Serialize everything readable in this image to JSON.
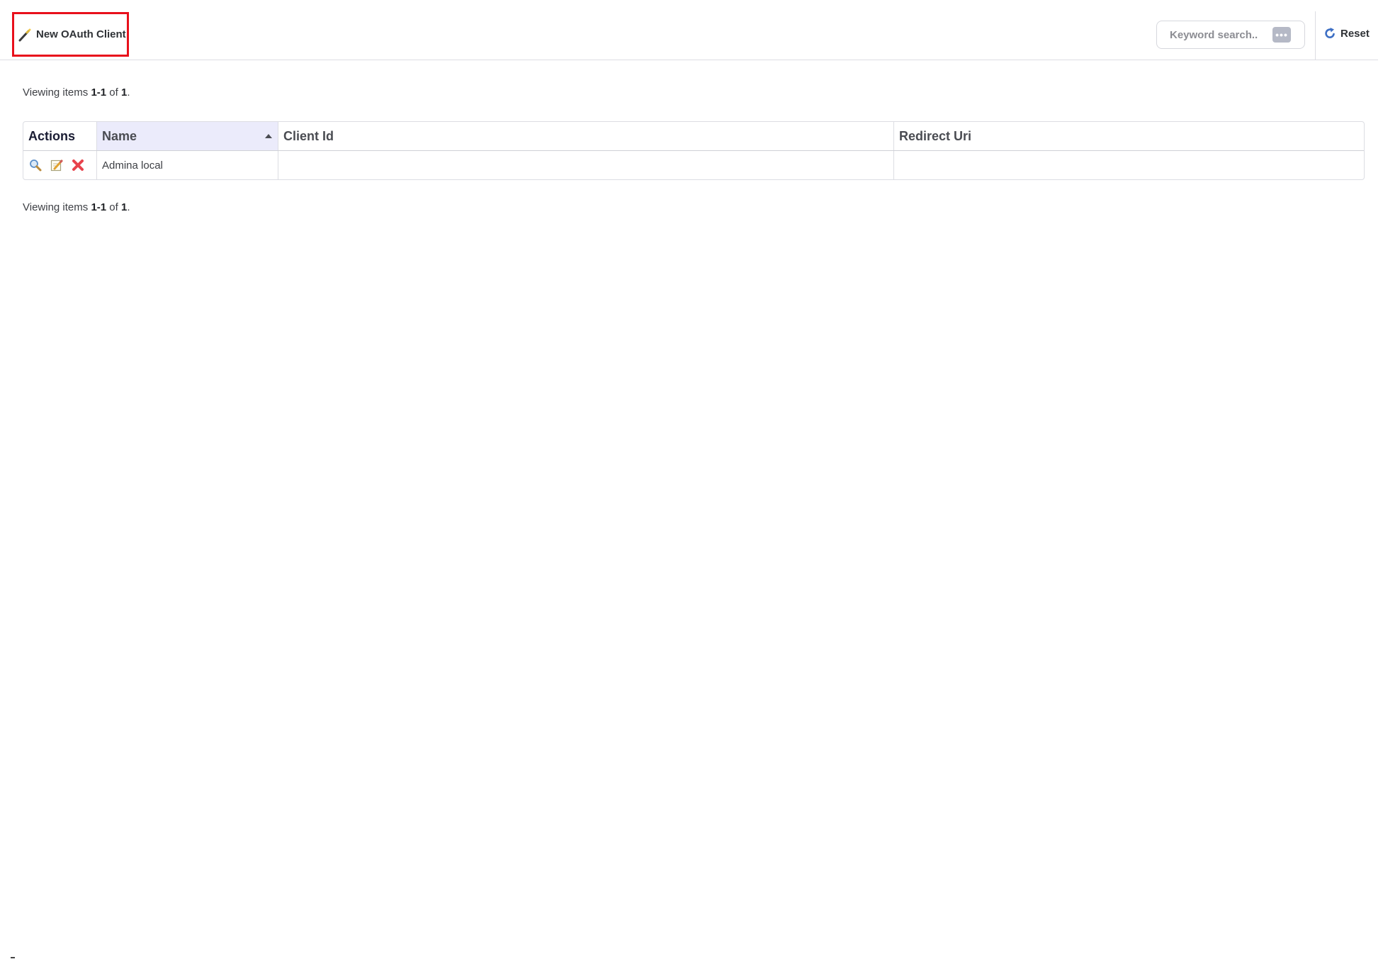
{
  "toolbar": {
    "new_label": "New OAuth Client",
    "search_placeholder": "Keyword search..",
    "more_label": "•••",
    "reset_label": "Reset"
  },
  "summary": {
    "prefix": "Viewing items",
    "range": "1-1",
    "of": "of",
    "total": "1",
    "suffix": "."
  },
  "grid": {
    "columns": [
      "Actions",
      "Name",
      "Client Id",
      "Redirect Uri"
    ],
    "sorted_column": "Name",
    "sort_direction": "ascending",
    "rows": [
      {
        "name": "Admina local",
        "client_id": "",
        "redirect_uri": ""
      }
    ],
    "row_actions": [
      "view-icon",
      "edit-icon",
      "delete-icon"
    ]
  },
  "colors": {
    "highlight_border": "#e8101b",
    "sorted_header_bg": "#ebebfb",
    "reset_icon": "#3d6fc4",
    "delete_icon": "#e8434c"
  }
}
